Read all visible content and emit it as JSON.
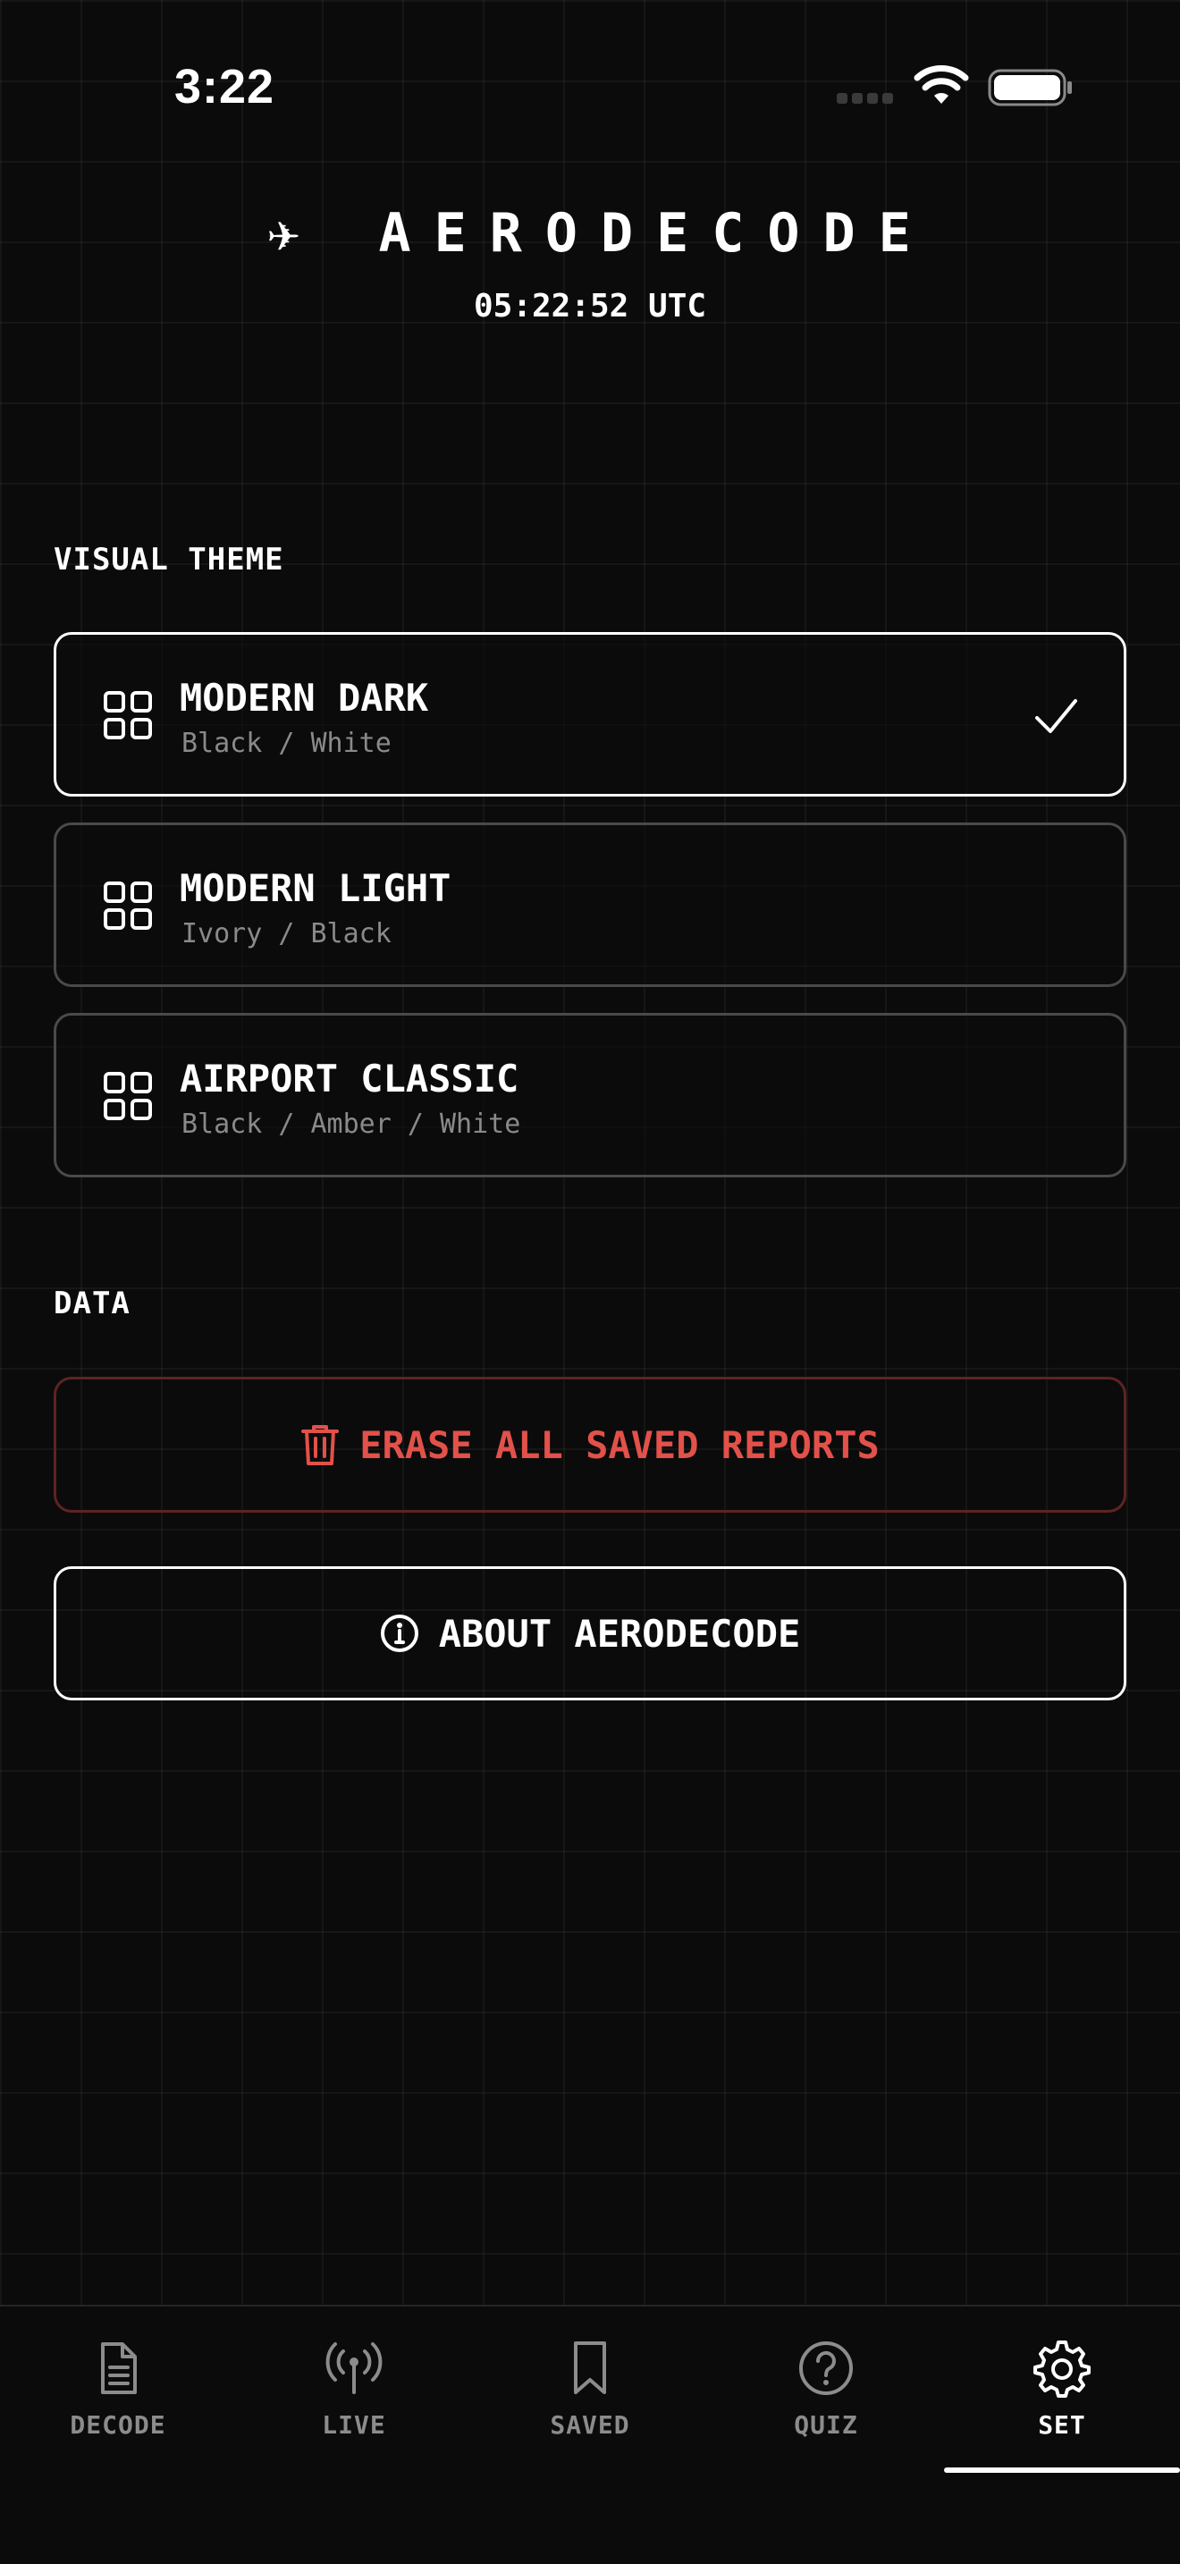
{
  "status_bar": {
    "time": "3:22"
  },
  "header": {
    "title": "✈ AERODECODE",
    "utc_time": "05:22:52 UTC"
  },
  "sections": {
    "visual_theme": "VISUAL THEME",
    "data": "DATA"
  },
  "themes": [
    {
      "name": "MODERN DARK",
      "colors": "Black / White",
      "selected": true
    },
    {
      "name": "MODERN LIGHT",
      "colors": "Ivory / Black",
      "selected": false
    },
    {
      "name": "AIRPORT CLASSIC",
      "colors": "Black / Amber / White",
      "selected": false
    }
  ],
  "actions": {
    "erase": "ERASE ALL SAVED REPORTS",
    "about": "ABOUT AERODECODE"
  },
  "colors": {
    "background": "#0b0b0b",
    "danger": "#e2514a",
    "muted": "#8c8c8c",
    "foreground": "#ffffff"
  },
  "tabs": [
    {
      "label": "DECODE",
      "icon": "document-icon"
    },
    {
      "label": "LIVE",
      "icon": "antenna-icon"
    },
    {
      "label": "SAVED",
      "icon": "bookmark-icon"
    },
    {
      "label": "QUIZ",
      "icon": "question-circle-icon"
    },
    {
      "label": "SET",
      "icon": "gear-icon",
      "active": true
    }
  ]
}
